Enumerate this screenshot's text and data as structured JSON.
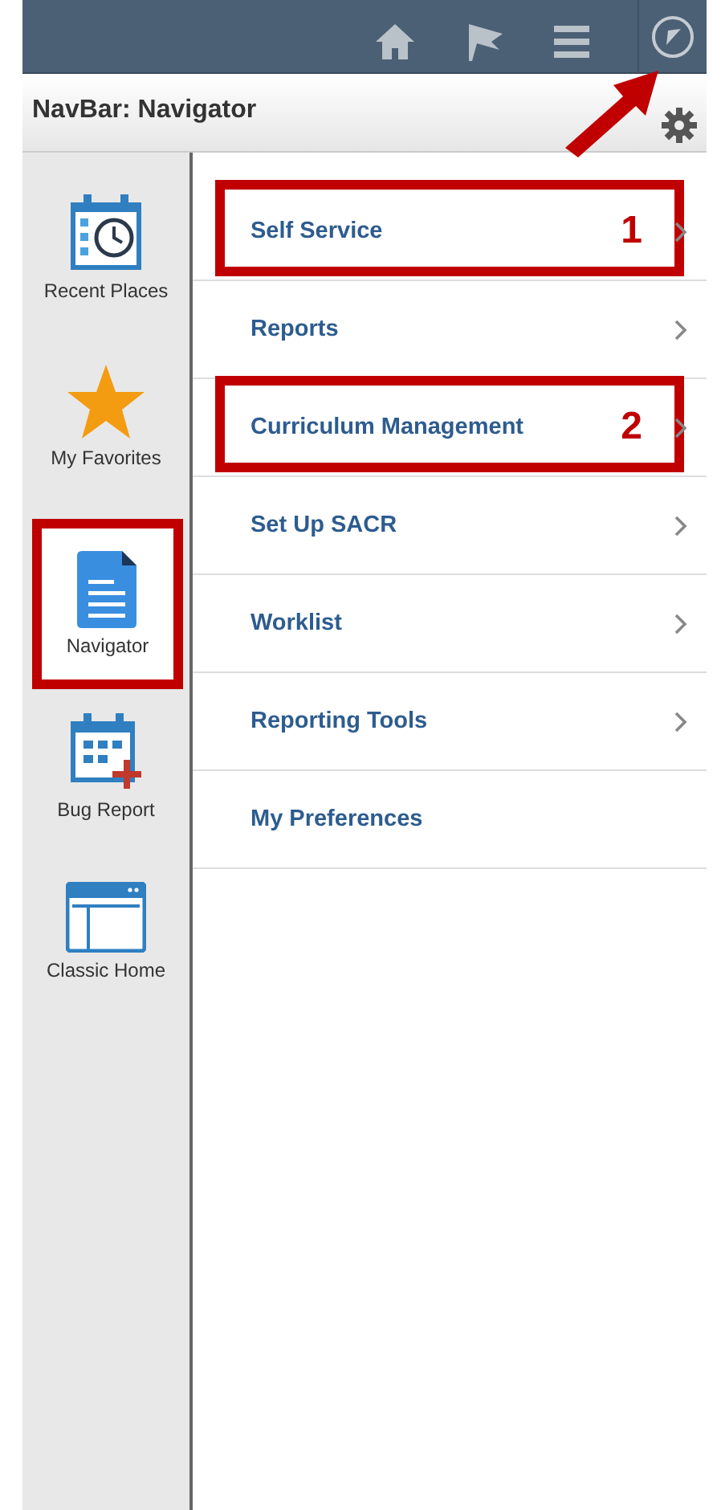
{
  "header": {
    "title": "NavBar: Navigator"
  },
  "sidebar": {
    "items": [
      {
        "label": "Recent Places",
        "kind": "recent",
        "selected": false,
        "highlighted": false
      },
      {
        "label": "My Favorites",
        "kind": "favorites",
        "selected": false,
        "highlighted": false
      },
      {
        "label": "Navigator",
        "kind": "navigator",
        "selected": true,
        "highlighted": true
      },
      {
        "label": "Bug Report",
        "kind": "bug",
        "selected": false,
        "highlighted": false
      },
      {
        "label": "Classic Home",
        "kind": "classic",
        "selected": false,
        "highlighted": false
      }
    ]
  },
  "menu": {
    "items": [
      {
        "label": "Self Service",
        "has_children": true,
        "highlighted": true,
        "callout": "1"
      },
      {
        "label": "Reports",
        "has_children": true,
        "highlighted": false
      },
      {
        "label": "Curriculum Management",
        "has_children": true,
        "highlighted": true,
        "callout": "2"
      },
      {
        "label": "Set Up SACR",
        "has_children": true,
        "highlighted": false
      },
      {
        "label": "Worklist",
        "has_children": true,
        "highlighted": false
      },
      {
        "label": "Reporting Tools",
        "has_children": true,
        "highlighted": false
      },
      {
        "label": "My Preferences",
        "has_children": false,
        "highlighted": false
      }
    ]
  }
}
